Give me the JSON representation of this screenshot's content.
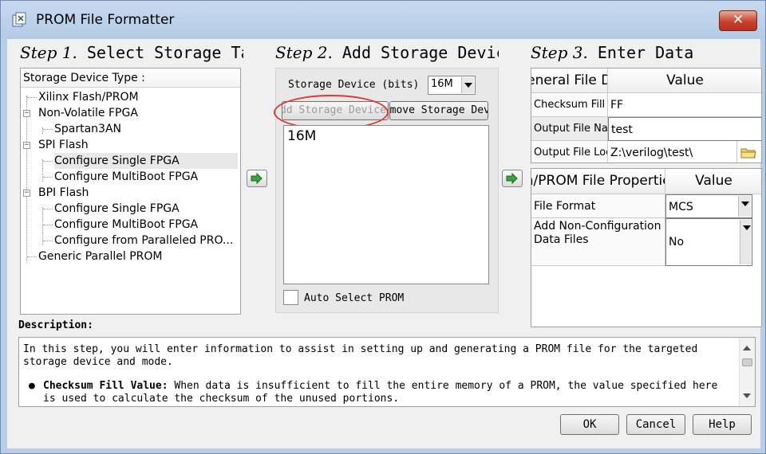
{
  "window": {
    "title": "PROM File Formatter",
    "close_label": "✕"
  },
  "step1": {
    "title_em": "Step 1.",
    "title_rest": " Select Storage Target",
    "tree_header": "Storage Device Type :",
    "items": [
      {
        "label": "Xilinx Flash/PROM",
        "level": 0,
        "expander": ""
      },
      {
        "label": "Non-Volatile FPGA",
        "level": 0,
        "expander": "−"
      },
      {
        "label": "Spartan3AN",
        "level": 1,
        "expander": ""
      },
      {
        "label": "SPI Flash",
        "level": 0,
        "expander": "−"
      },
      {
        "label": "Configure Single FPGA",
        "level": 1,
        "expander": "",
        "selected": true
      },
      {
        "label": "Configure MultiBoot FPGA",
        "level": 1,
        "expander": ""
      },
      {
        "label": "BPI Flash",
        "level": 0,
        "expander": "−"
      },
      {
        "label": "Configure Single FPGA",
        "level": 1,
        "expander": ""
      },
      {
        "label": "Configure MultiBoot FPGA",
        "level": 1,
        "expander": ""
      },
      {
        "label": "Configure from Paralleled PRO...",
        "level": 1,
        "expander": ""
      },
      {
        "label": "Generic Parallel PROM",
        "level": 0,
        "expander": ""
      }
    ]
  },
  "step2": {
    "title_em": "Step 2.",
    "title_rest": " Add Storage Device(s)",
    "storage_label": "Storage Device (bits)",
    "storage_value": "16M",
    "add_button": "Add Storage Device",
    "remove_button": "Remove Storage Device",
    "list_items": [
      "16M"
    ],
    "auto_select_label": "Auto Select PROM"
  },
  "step3": {
    "title_em": "Step 3.",
    "title_rest": "     Enter Data",
    "general_header": "General File Detail",
    "value_header": "Value",
    "general_rows": [
      {
        "label": "Checksum Fill Value",
        "value": "FF"
      },
      {
        "label": "Output File Name",
        "value": "test"
      },
      {
        "label": "Output File Location",
        "value": "Z:\\verilog\\test\\"
      }
    ],
    "prom_header": "Flash/PROM File Properties",
    "prom_value_header": "Value",
    "prom_rows": [
      {
        "label": "File Format",
        "value": "MCS"
      },
      {
        "label": "Add Non-Configuration Data Files",
        "value": "No"
      }
    ]
  },
  "description": {
    "label": "Description:",
    "text": "In this step, you will enter information to assist in setting up and generating a PROM file for the targeted storage device and mode.",
    "bullet_bold": "Checksum Fill Value:",
    "bullet_text": " When data is insufficient to fill the entire memory of a PROM, the value specified here is used to calculate the checksum of the unused portions."
  },
  "footer": {
    "ok": "OK",
    "cancel": "Cancel",
    "help": "Help"
  }
}
